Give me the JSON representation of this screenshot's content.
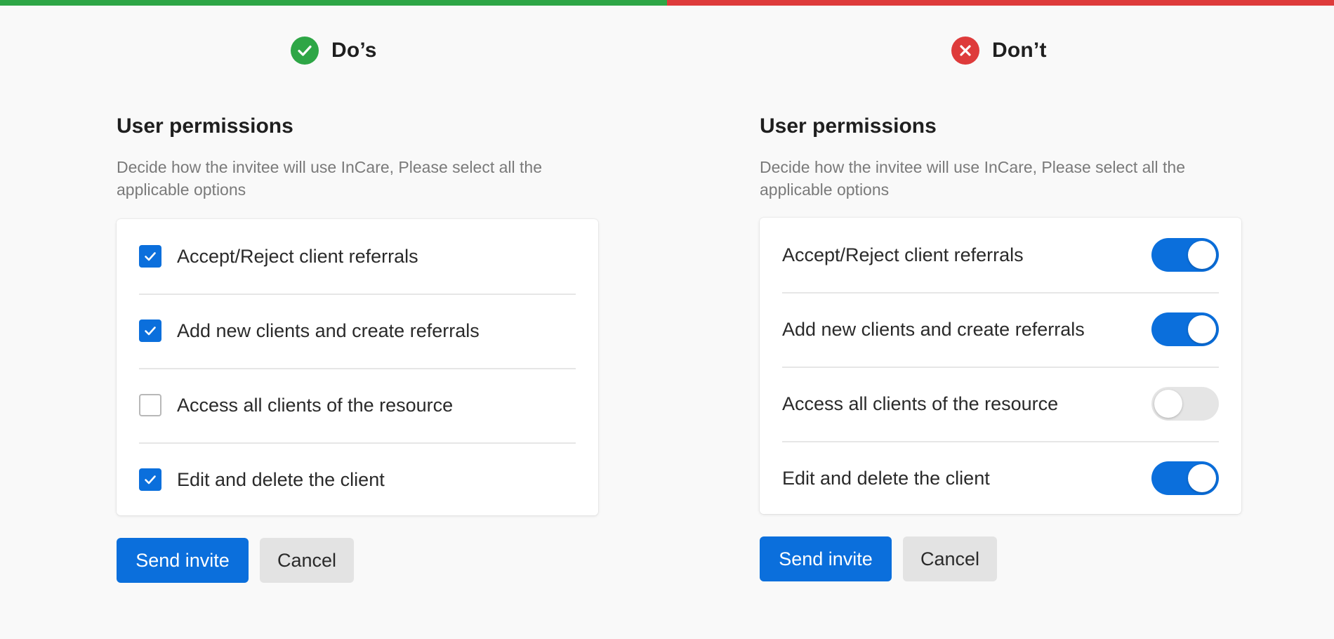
{
  "colors": {
    "do_accent": "#2ea646",
    "dont_accent": "#de3b3b",
    "primary": "#0b6fdc",
    "secondary_button": "#e3e3e3"
  },
  "dos": {
    "heading": "Do’s",
    "icon": "check-circle-icon",
    "title": "User permissions",
    "description": "Decide how the invitee will use InCare, Please select all the applicable options",
    "options": [
      {
        "label": "Accept/Reject client referrals",
        "checked": true
      },
      {
        "label": "Add new clients and create referrals",
        "checked": true
      },
      {
        "label": "Access all clients of the resource",
        "checked": false
      },
      {
        "label": "Edit and delete the client",
        "checked": true
      }
    ],
    "primary_button": "Send invite",
    "secondary_button": "Cancel"
  },
  "donts": {
    "heading": "Don’t",
    "icon": "x-circle-icon",
    "title": "User permissions",
    "description": "Decide how the invitee will use InCare, Please select all the applicable options",
    "options": [
      {
        "label": "Accept/Reject client referrals",
        "on": true
      },
      {
        "label": "Add new clients and create referrals",
        "on": true
      },
      {
        "label": "Access all clients of the resource",
        "on": false
      },
      {
        "label": "Edit and delete the client",
        "on": true
      }
    ],
    "primary_button": "Send invite",
    "secondary_button": "Cancel"
  }
}
